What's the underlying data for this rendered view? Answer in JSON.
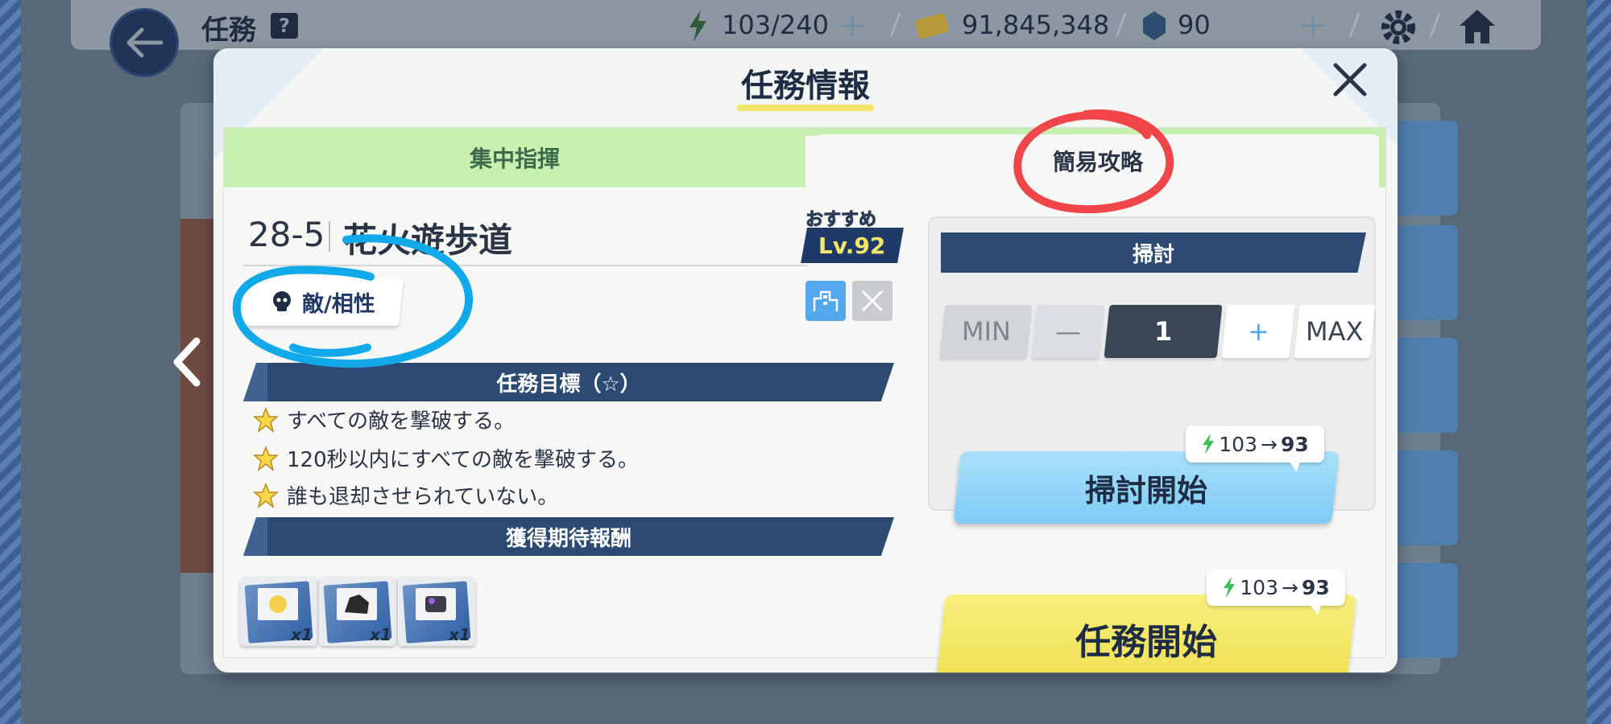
{
  "header": {
    "title": "任務",
    "help_label": "?",
    "ap": "103/240",
    "credits": "91,845,348",
    "gems": "90"
  },
  "modal": {
    "title": "任務情報",
    "tabs": [
      {
        "label": "集中指揮"
      },
      {
        "label": "簡易攻略"
      }
    ]
  },
  "stage": {
    "code": "28-5",
    "name": "花火遊歩道",
    "recommended_label": "おすすめ",
    "recommended_level": "Lv.92",
    "enemy_button": "敵/相性"
  },
  "goals": {
    "header": "任務目標（☆）",
    "items": [
      "すべての敵を撃破する。",
      "120秒以内にすべての敵を撃破する。",
      "誰も退却させられていない。"
    ]
  },
  "rewards": {
    "header": "獲得期待報酬",
    "items": [
      {
        "qty": "x1"
      },
      {
        "qty": "x1"
      },
      {
        "qty": "x1"
      }
    ]
  },
  "sweep": {
    "header": "掃討",
    "min_label": "MIN",
    "minus_label": "—",
    "count": "1",
    "plus_label": "+",
    "max_label": "MAX",
    "cost_from": "103",
    "cost_arrow": "→",
    "cost_to": "93",
    "start_label": "掃討開始"
  },
  "mission": {
    "cost_from": "103",
    "cost_arrow": "→",
    "cost_to": "93",
    "start_label": "任務開始"
  },
  "colors": {
    "accent_yellow": "#f3e76a",
    "navy": "#2c4a72",
    "tab_green": "#c7f0b0",
    "annotation_red": "#f0464a",
    "annotation_blue": "#12a9ea"
  }
}
